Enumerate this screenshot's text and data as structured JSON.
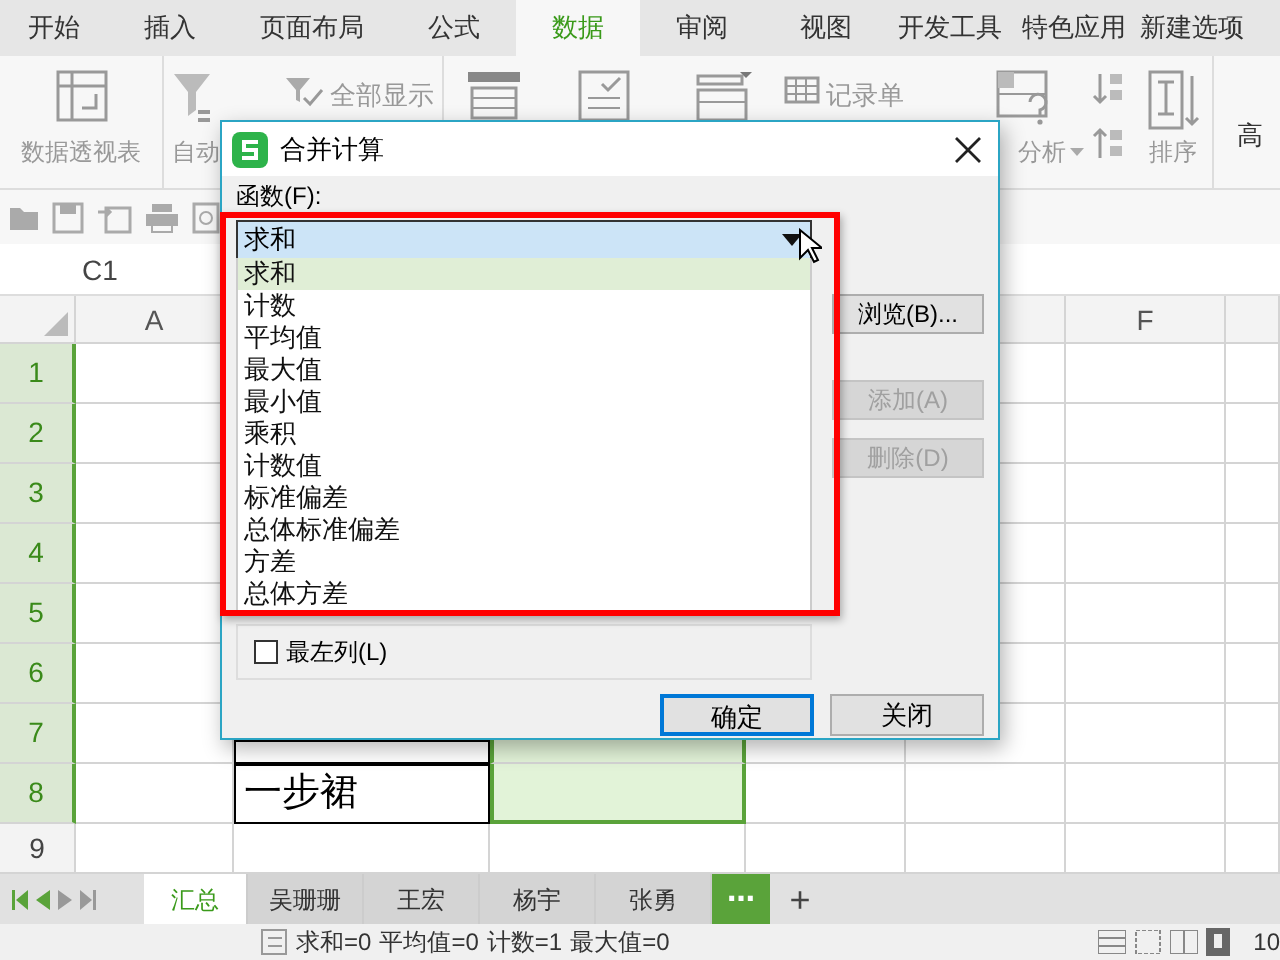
{
  "ribbon_tabs": [
    {
      "label": "开始",
      "selected": false
    },
    {
      "label": "插入",
      "selected": false
    },
    {
      "label": "页面布局",
      "selected": false
    },
    {
      "label": "公式",
      "selected": false
    },
    {
      "label": "数据",
      "selected": true
    },
    {
      "label": "审阅",
      "selected": false
    },
    {
      "label": "视图",
      "selected": false
    },
    {
      "label": "开发工具",
      "selected": false
    },
    {
      "label": "特色应用",
      "selected": false
    },
    {
      "label": "新建选项",
      "selected": false
    }
  ],
  "ribbon_items": [
    {
      "kind": "large",
      "label": "数据透视表"
    },
    {
      "kind": "large",
      "label": "自动"
    },
    {
      "kind": "small",
      "label": "全部显示"
    },
    {
      "kind": "large"
    },
    {
      "kind": "large"
    },
    {
      "kind": "large"
    },
    {
      "kind": "small",
      "label": "记录单"
    },
    {
      "kind": "dropdown",
      "label": "分析"
    },
    {
      "kind": "stack"
    },
    {
      "kind": "large",
      "label": "排序"
    },
    {
      "kind": "text",
      "label": "高"
    }
  ],
  "name_box": "C1",
  "columns": [
    {
      "label": "A"
    },
    {},
    {},
    {},
    {},
    {
      "label": "F"
    },
    {}
  ],
  "rows": [
    {
      "header": "1",
      "selected": true
    },
    {
      "header": "2",
      "selected": true
    },
    {
      "header": "3",
      "selected": true
    },
    {
      "header": "4",
      "selected": true
    },
    {
      "header": "5",
      "selected": true
    },
    {
      "header": "6",
      "selected": true
    },
    {
      "header": "7",
      "selected": true
    },
    {
      "header": "8",
      "selected": true,
      "column_b": "一步裙"
    },
    {
      "header": "9",
      "selected": false
    }
  ],
  "sheet_tabs": [
    {
      "label": "汇总",
      "selected": true
    },
    {
      "label": "吴珊珊",
      "selected": false
    },
    {
      "label": "王宏",
      "selected": false
    },
    {
      "label": "杨宇",
      "selected": false
    },
    {
      "label": "张勇",
      "selected": false
    }
  ],
  "more_sheets": "⋯",
  "add_sheet": "+",
  "status_items": [
    "求和=0",
    "平均值=0",
    "计数=1",
    "最大值=0"
  ],
  "zoom_text": "10",
  "dialog": {
    "title": "合并计算",
    "function_label": "函数(F):",
    "function_value": "求和",
    "function_options": [
      {
        "label": "求和",
        "selected": true
      },
      {
        "label": "计数",
        "selected": false
      },
      {
        "label": "平均值",
        "selected": false
      },
      {
        "label": "最大值",
        "selected": false
      },
      {
        "label": "最小值",
        "selected": false
      },
      {
        "label": "乘积",
        "selected": false
      },
      {
        "label": "计数值",
        "selected": false
      },
      {
        "label": "标准偏差",
        "selected": false
      },
      {
        "label": "总体标准偏差",
        "selected": false
      },
      {
        "label": "方差",
        "selected": false
      },
      {
        "label": "总体方差",
        "selected": false
      }
    ],
    "side_buttons": [
      {
        "label": "浏览(B)...",
        "disabled": false
      },
      {
        "label": "添加(A)",
        "disabled": true
      },
      {
        "label": "删除(D)",
        "disabled": true
      }
    ],
    "checkbox": {
      "label": "最左列(L)",
      "checked": false
    },
    "footer_buttons": [
      {
        "label": "确定",
        "default": true
      },
      {
        "label": "关闭",
        "default": false
      }
    ],
    "highlight_frame": true
  }
}
